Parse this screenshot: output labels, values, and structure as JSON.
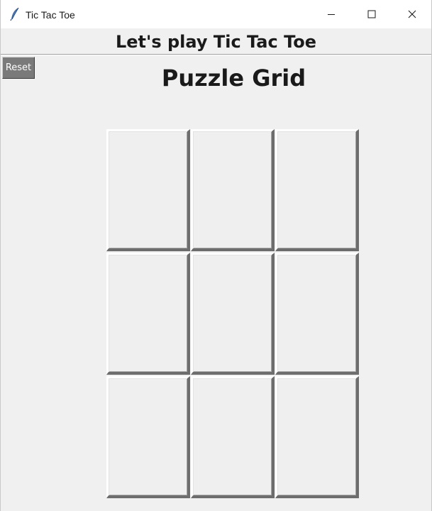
{
  "window": {
    "title": "Tic Tac Toe",
    "app_icon": "feather-icon",
    "controls": {
      "minimize_icon": "minimize-icon",
      "maximize_icon": "maximize-icon",
      "close_icon": "close-icon"
    }
  },
  "header": {
    "title": "Let's play Tic Tac Toe"
  },
  "toolbar": {
    "reset_label": "Reset"
  },
  "game": {
    "grid_title": "Puzzle Grid",
    "cells": [
      [
        "",
        "",
        ""
      ],
      [
        "",
        "",
        ""
      ],
      [
        "",
        "",
        ""
      ]
    ]
  },
  "colors": {
    "background": "#f0f0f0",
    "reset_button": "#7a7a7a",
    "cell_face": "#efefef"
  }
}
